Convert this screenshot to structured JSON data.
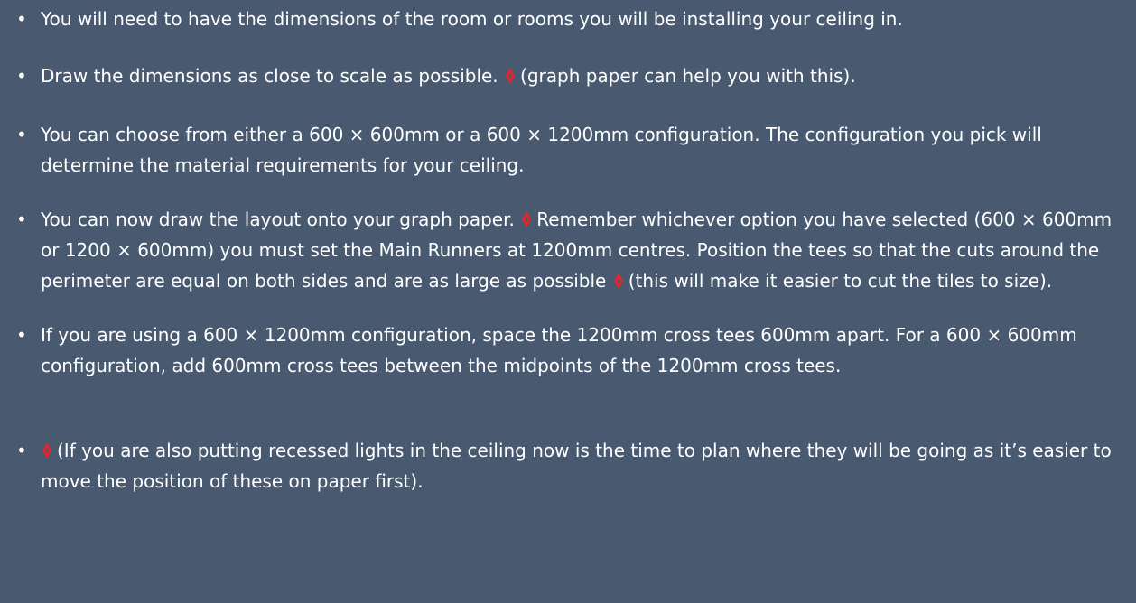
{
  "bullet_char": "•",
  "colors": {
    "background": "#495a70",
    "text": "#ffffff",
    "marker": "#e3262b"
  },
  "icons": {
    "marker": "diamond-marker-icon"
  },
  "items": [
    {
      "parts": [
        {
          "type": "text",
          "text": "You will need to have the dimensions of the room or rooms you will be installing your ceiling in."
        }
      ]
    },
    {
      "parts": [
        {
          "type": "text",
          "text": "Draw the dimensions as close to scale as possible. "
        },
        {
          "type": "marker"
        },
        {
          "type": "text",
          "text": "(graph paper can help you with this)."
        }
      ]
    },
    {
      "parts": [
        {
          "type": "text",
          "text": "You can choose from either a 600 × 600mm or a 600 × 1200mm configuration. The configuration you pick will determine the material requirements for your ceiling."
        }
      ]
    },
    {
      "parts": [
        {
          "type": "text",
          "text": "You can now draw the layout onto your graph paper. "
        },
        {
          "type": "marker"
        },
        {
          "type": "text",
          "text": "Remember whichever option you have selected (600 × 600mm or 1200 × 600mm) you must set the Main Runners at 1200mm centres. Position the tees so that the cuts around the perimeter are equal on both sides and are as large as possible "
        },
        {
          "type": "marker"
        },
        {
          "type": "text",
          "text": "(this will make it easier to cut the tiles to size)."
        }
      ]
    },
    {
      "parts": [
        {
          "type": "text",
          "text": "If you are using a 600 × 1200mm configuration, space the 1200mm cross tees 600mm apart. For a 600 × 600mm configuration, add 600mm cross tees between the midpoints of the 1200mm cross tees."
        }
      ]
    },
    {
      "parts": [
        {
          "type": "marker"
        },
        {
          "type": "text",
          "text": "(If you are also putting recessed lights in the ceiling now is the time to plan where they will be going as it’s easier to move the position of these on paper first)."
        }
      ]
    }
  ]
}
